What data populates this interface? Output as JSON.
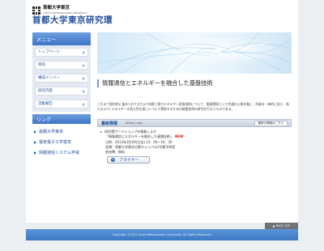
{
  "header": {
    "logo_jp": "首都大学東京",
    "logo_en": "TOKYO METROPOLITAN UNIVERSITY",
    "site_title": "首都大学東京研究環"
  },
  "sidebar": {
    "menu_title": "メニュー",
    "menu_items": [
      {
        "label": "トップページ"
      },
      {
        "label": "目的"
      },
      {
        "label": "構成メンバー"
      },
      {
        "label": "研究内容"
      },
      {
        "label": "活動報告"
      }
    ],
    "links_title": "リンク",
    "links": [
      {
        "label": "首都大学東京"
      },
      {
        "label": "電気電子工学専攻"
      },
      {
        "label": "情報通信システム学域"
      }
    ]
  },
  "main": {
    "heading": "情報通信とエネルギーを融合した基盤技術",
    "paragraph": "これまで個別的に進められてきたICT技術と電力エネルギー変換技術について、電磁環境という共通の土俵を軸に、両者を一体的に捉え、新たなICTとエネルギーの両立性を高いレベルで実現するための基盤技術の研究を行なうものである。"
  },
  "news": {
    "title": "最新情報",
    "subtitle": "What's new",
    "more_label": "最新の情報はこちら",
    "lines": [
      {
        "text": "研究環ワークショップを開催します"
      },
      {
        "text": "「情報通信とエネルギーを融合した基盤技術」",
        "badge": "NEW"
      },
      {
        "text": "日時：2013年3月29日(金) 13：00〜16：30"
      },
      {
        "text": "会場：首都大学東京日野キャンパス2号館300室"
      },
      {
        "text": "参加費：無料"
      }
    ],
    "flyer_label": "フライヤー"
  },
  "footer": {
    "pagetop": "▲ PAGE TOP",
    "copyright": "Copyright ©2012 Tokyo Metropolitan University. All Rights Reserved."
  },
  "colors": {
    "brand_blue": "#1f4e9a",
    "menu_gradient_top": "#6e9ee0",
    "menu_gradient_bottom": "#3d74c7",
    "new_badge": "#d21b1b"
  }
}
